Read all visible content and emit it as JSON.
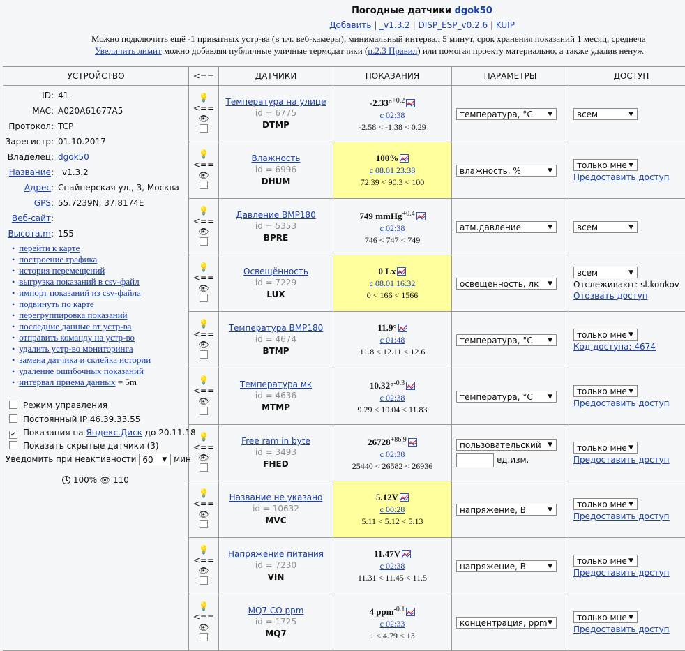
{
  "header": {
    "title_prefix": "Погодные датчики",
    "title_user": "dgok50",
    "links": [
      "Добавить",
      "_v1.3.2",
      "DISP_ESP_v0.2.6",
      "KUIP"
    ],
    "info_line1": "Можно подключить ещё -1 приватных устр-ва (в т.ч. веб-камеры), минимальный интервал 5 минут, срок хранения показаний 1 месяц, среднеча",
    "info_line2_link1": "Увеличить лимит",
    "info_line2_text1": " можно добавляя публичные уличные термодатчики (",
    "info_line2_link2": "п.2.3 Правил",
    "info_line2_text2": ") или помогая проекту материально, а также удалив ненуж"
  },
  "columns": [
    "УСТРОЙСТВО",
    "<==",
    "ДАТЧИКИ",
    "ПОКАЗАНИЯ",
    "ПАРАМЕТРЫ",
    "ДОСТУП"
  ],
  "device": {
    "id_label": "ID:",
    "id": "41",
    "mac_label": "MAC:",
    "mac": "A020A61677A5",
    "protocol_label": "Протокол:",
    "protocol": "TCP",
    "registered_label": "Зарегистр:",
    "registered": "01.10.2017",
    "owner_label": "Владелец:",
    "owner": "dgok50",
    "name_label": "Название",
    "name": "_v1.3.2",
    "address_label": "Адрес",
    "address": "Снайперская ул., 3, Москва",
    "gps_label": "GPS",
    "gps": "55.7239N, 37.8174E",
    "website_label": "Веб-сайт",
    "height_label": "Высота,m",
    "height": "155"
  },
  "device_links": [
    "перейти к карте",
    "построение графика",
    "история перемещений",
    "выгрузка показаний в csv-файл",
    "импорт показаний из csv-файла",
    "подвинуть по карте",
    "перегруппировка показаний",
    "последние данные от устр-ва",
    "отправить команду на устр-во",
    "удалить устр-во мониторинга",
    "замена датчика и склейка истории",
    "удаление ошибочных показаний",
    "интервал приема данных"
  ],
  "interval_suffix": " = 5m",
  "options": {
    "control_mode": "Режим управления",
    "static_ip": "Постоянный IP 46.39.33.55",
    "yadisk_prefix": "Показания на ",
    "yadisk_link": "Яндекс.Диск",
    "yadisk_suffix": " до 20.11.18",
    "hidden_sensors": "Показать скрытые датчики (3)",
    "notify_label": "Уведомить при неактивности",
    "notify_value": "60",
    "notify_unit": "мин"
  },
  "status": {
    "uptime": "100%",
    "views": "110"
  },
  "sensors": [
    {
      "name": "Температура на улице",
      "id": "id = 6775",
      "code": "DTMP",
      "value": "-2.33°",
      "delta": "+0.2",
      "time": "с 02:38",
      "range": "-2.58 < -1.38 < 0.29",
      "highlight": false,
      "param": "температура, °C",
      "access": "всем",
      "access_note": "",
      "access_link": ""
    },
    {
      "name": "Влажность",
      "id": "id = 6996",
      "code": "DHUM",
      "value": "100%",
      "delta": "",
      "time": "с 08.01 23:38",
      "range": "72.39 < 90.3 < 100",
      "highlight": true,
      "param": "влажность, %",
      "access": "только мне",
      "access_note": "",
      "access_link": "Предоставить доступ"
    },
    {
      "name": "Давление BMP180",
      "id": "id = 5353",
      "code": "BPRE",
      "value": "749 mmHg",
      "delta": "+0.4",
      "time": "с 02:38",
      "range": "746 < 747 < 749",
      "highlight": false,
      "param": "атм.давление",
      "access": "всем",
      "access_note": "",
      "access_link": ""
    },
    {
      "name": "Освещённость",
      "id": "id = 7229",
      "code": "LUX",
      "value": "0 Lx",
      "delta": "",
      "time": "с 08.01 16:32",
      "range": "0 < 166 < 1566",
      "highlight": true,
      "param": "освещенность, лк",
      "access": "всем",
      "access_note": "Отслеживают: sl.konkov",
      "access_link": "Отозвать доступ"
    },
    {
      "name": "Температура BMP180",
      "id": "id = 4674",
      "code": "BTMP",
      "value": "11.9°",
      "delta": "",
      "time": "с 01:48",
      "range": "11.8 < 12.11 < 12.6",
      "highlight": false,
      "param": "температура, °C",
      "access": "только мне",
      "access_note": "",
      "access_link": "Код доступа: 4674"
    },
    {
      "name": "Температура мк",
      "id": "id = 4636",
      "code": "MTMP",
      "value": "10.32°",
      "delta": "-0.3",
      "time": "с 02:38",
      "range": "9.29 < 10.04 < 11.83",
      "highlight": false,
      "param": "температура, °C",
      "access": "только мне",
      "access_note": "",
      "access_link": "Предоставить доступ"
    },
    {
      "name": "Free ram in byte",
      "id": "id = 3493",
      "code": "FHED",
      "value": "26728",
      "delta": "+86.9",
      "time": "с 02:38",
      "range": "25440 < 26582 < 26936",
      "highlight": false,
      "param": "пользовательский",
      "unit_label": "ед.изм.",
      "access": "только мне",
      "access_note": "",
      "access_link": "Предоставить доступ"
    },
    {
      "name": "Название не указано",
      "id": "id = 10632",
      "code": "MVC",
      "value": "5.12V",
      "delta": "",
      "time": "с 00:28",
      "range": "5.11 < 5.12 < 5.13",
      "highlight": true,
      "param": "напряжение, В",
      "access": "только мне",
      "access_note": "",
      "access_link": "Предоставить доступ"
    },
    {
      "name": "Напряжение питания",
      "id": "id = 7230",
      "code": "VIN",
      "value": "11.47V",
      "delta": "",
      "time": "с 02:38",
      "range": "11.31 < 11.45 < 11.5",
      "highlight": false,
      "param": "напряжение, В",
      "access": "только мне",
      "access_note": "",
      "access_link": "Предоставить доступ"
    },
    {
      "name": "MQ7 CO ppm",
      "id": "id = 1725",
      "code": "MQ7",
      "value": "4 ppm",
      "delta": "-0.1",
      "time": "с 02:33",
      "range": "1 < 4.79 < 13",
      "highlight": false,
      "param": "концентрация, ppm",
      "access": "только мне",
      "access_note": "",
      "access_link": "Предоставить доступ"
    }
  ],
  "icons": {
    "bulb": "lightbulb-icon",
    "arrow": "move-left-icon",
    "eye": "eye-icon",
    "chart": "chart-icon",
    "clock": "clock-icon"
  }
}
